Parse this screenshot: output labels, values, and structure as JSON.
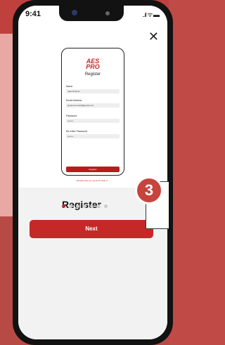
{
  "status_bar": {
    "time": "9:41",
    "signal": "..ıl ᯤ ▬"
  },
  "close_symbol": "✕",
  "mock": {
    "logo_line1": "AES",
    "logo_line2": "PRO",
    "title": "Register",
    "fields": [
      {
        "label": "Name",
        "value": "Jack Roberts"
      },
      {
        "label": "Email Address",
        "value": "jackpmoore123@gmail.com"
      },
      {
        "label": "Password",
        "value": "••••••••"
      },
      {
        "label": "Re-enter Password",
        "value": "••••••••"
      }
    ],
    "button": "Register",
    "link": "Already have an account? Sign in"
  },
  "heading": "Register",
  "pager": {
    "total": 7,
    "active": 0
  },
  "next_button": "Next",
  "badge": "3",
  "colors": {
    "accent": "#c62828",
    "badge": "#c6443c"
  }
}
